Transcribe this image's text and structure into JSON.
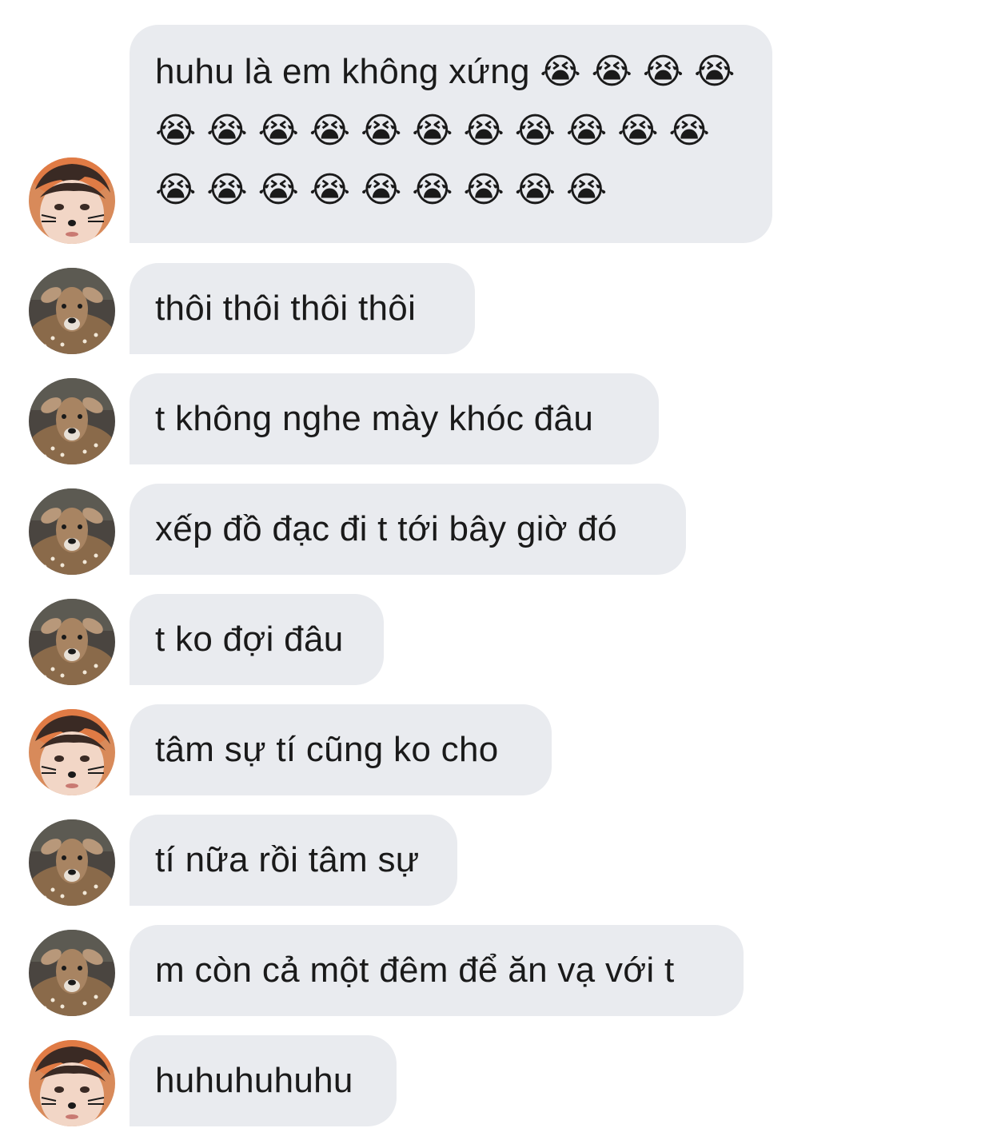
{
  "conversation": {
    "messages": [
      {
        "sender": "boy",
        "text": "huhu là em không xứng 😭 😭 😭 😭 😭 😭 😭 😭 😭 😭 😭 😭 😭 😭 😭 😭 😭 😭 😭 😭 😭 😭 😭 😭"
      },
      {
        "sender": "deer",
        "text": "thôi thôi thôi thôi"
      },
      {
        "sender": "deer",
        "text": "t không nghe mày khóc đâu"
      },
      {
        "sender": "deer",
        "text": "xếp đồ đạc đi t tới bây giờ đó"
      },
      {
        "sender": "deer",
        "text": "t ko đợi đâu"
      },
      {
        "sender": "boy",
        "text": "tâm sự tí cũng ko cho"
      },
      {
        "sender": "deer",
        "text": "tí nữa rồi tâm sự"
      },
      {
        "sender": "deer",
        "text": "m còn cả một đêm để ăn vạ với t"
      },
      {
        "sender": "boy",
        "text": "huhuhuhuhu"
      }
    ]
  },
  "colors": {
    "bubble_background": "#e9ebef",
    "text": "#1a1a1a",
    "background": "#ffffff"
  }
}
